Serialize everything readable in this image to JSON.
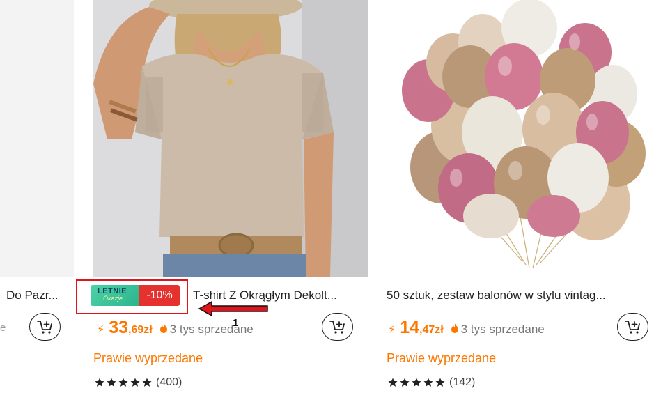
{
  "products": [
    {
      "title": "Do Pazr...",
      "stub_text": "e"
    },
    {
      "title": "T-shirt Z Okrągłym Dekolt...",
      "price_int": "33",
      "price_dec": ",69zł",
      "sold": "3 tys sprzedane",
      "status": "Prawie wyprzedane",
      "reviews": "(400)",
      "rating_value": 4.5,
      "badge": {
        "line1": "LETNIE",
        "line2": "Okazje",
        "discount": "-10%"
      }
    },
    {
      "title": "50 sztuk, zestaw balonów w stylu vintag...",
      "price_int": "14",
      "price_dec": ",47zł",
      "sold": "3 tys sprzedane",
      "status": "Prawie wyprzedane",
      "reviews": "(142)",
      "rating_value": 4.5
    }
  ],
  "annotation": {
    "label": "1",
    "color": "#e0141b"
  },
  "colors": {
    "accent": "#fb7701",
    "badge_red": "#e5322f",
    "badge_green": "#2ab58d"
  },
  "icons": [
    "add-to-cart-icon",
    "lightning-icon",
    "fire-icon",
    "star-icon",
    "arrow-left-icon"
  ]
}
